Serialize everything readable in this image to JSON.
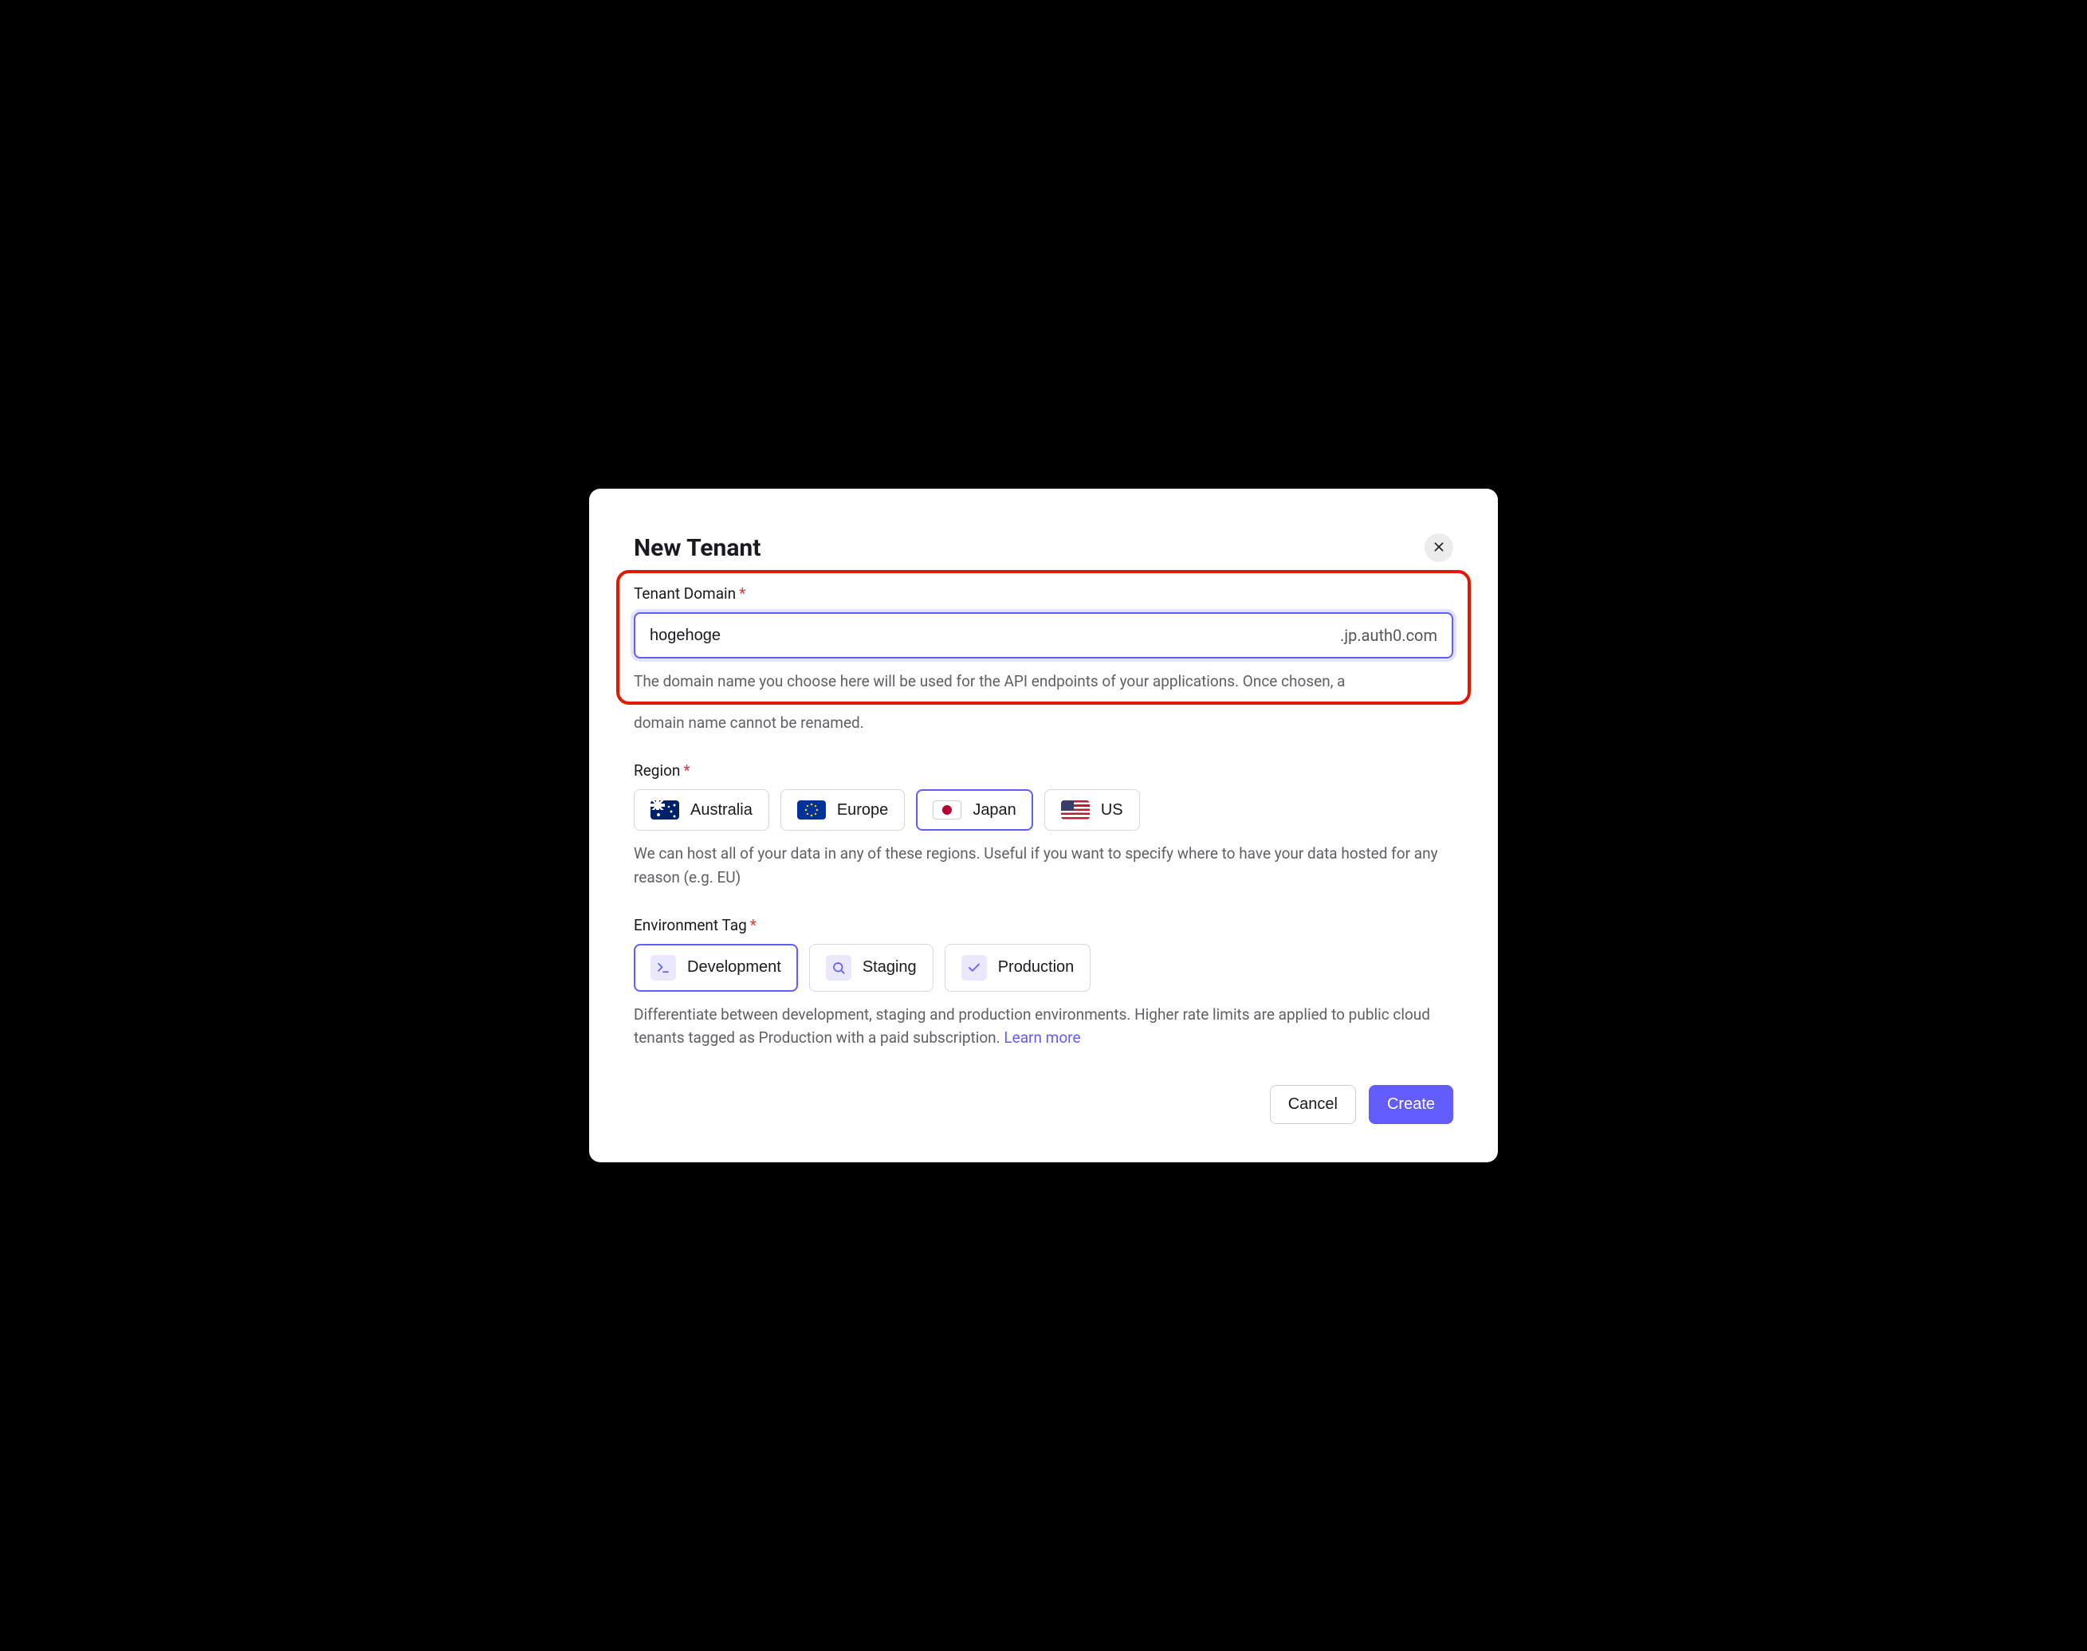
{
  "dialog": {
    "title": "New Tenant",
    "close_label": "Close"
  },
  "tenant_domain": {
    "label": "Tenant Domain",
    "required_marker": "*",
    "value": "hogehoge",
    "suffix": ".jp.auth0.com",
    "help": "The domain name you choose here will be used for the API endpoints of your applications. Once chosen, a domain name cannot be renamed.",
    "help_part1": "The domain name you choose here will be used for the API endpoints of your applications. Once chosen, a",
    "help_part2": "domain name cannot be renamed."
  },
  "region": {
    "label": "Region",
    "required_marker": "*",
    "options": [
      {
        "label": "Australia",
        "flag": "au",
        "selected": false
      },
      {
        "label": "Europe",
        "flag": "eu",
        "selected": false
      },
      {
        "label": "Japan",
        "flag": "jp",
        "selected": true
      },
      {
        "label": "US",
        "flag": "us",
        "selected": false
      }
    ],
    "help": "We can host all of your data in any of these regions. Useful if you want to specify where to have your data hosted for any reason (e.g. EU)"
  },
  "environment": {
    "label": "Environment Tag",
    "required_marker": "*",
    "options": [
      {
        "label": "Development",
        "icon": "terminal",
        "selected": true
      },
      {
        "label": "Staging",
        "icon": "search",
        "selected": false
      },
      {
        "label": "Production",
        "icon": "check",
        "selected": false
      }
    ],
    "help_prefix": "Differentiate between development, staging and production environments. Higher rate limits are applied to public cloud tenants tagged as Production with a paid subscription. ",
    "learn_more": "Learn more"
  },
  "footer": {
    "cancel": "Cancel",
    "create": "Create"
  }
}
